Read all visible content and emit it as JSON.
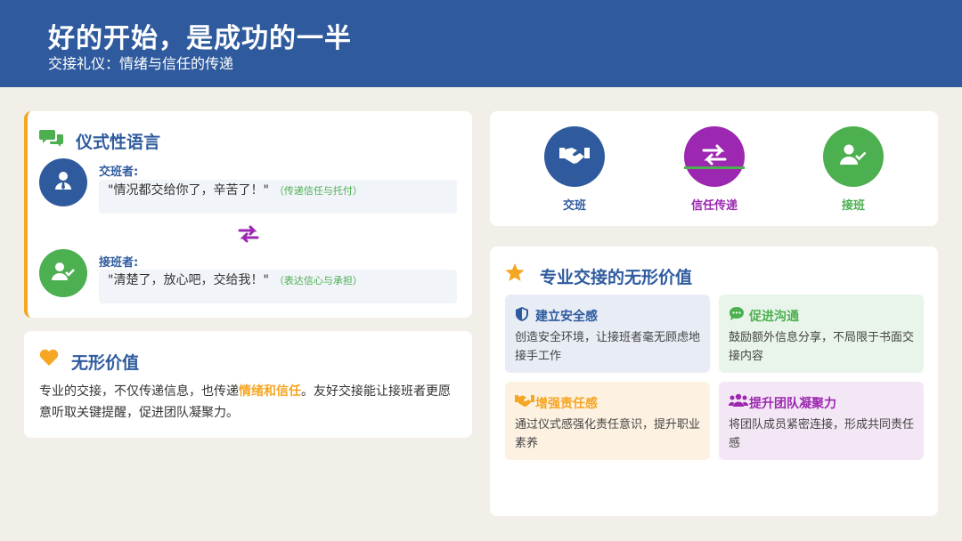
{
  "header": {
    "title": "好的开始，是成功的一半",
    "subtitle": "交接礼仪：情绪与信任的传递"
  },
  "ritual": {
    "title": "仪式性语言",
    "handover": {
      "role": "交班者:",
      "quote": "\"情况都交给你了，辛苦了！\"",
      "note": "（传递信任与托付）"
    },
    "takeover": {
      "role": "接班者:",
      "quote": "\"清楚了，放心吧，交给我！\"",
      "note": "（表达信心与承担）"
    }
  },
  "value": {
    "title": "无形价值",
    "text_before": "专业的交接，不仅传递信息，也传递",
    "text_highlight": "情绪和信任",
    "text_after": "。友好交接能让接班者更愿意听取关键提醒，促进团队凝聚力。"
  },
  "flow": {
    "steps": [
      {
        "label": "交班",
        "color": "#2f5b9e"
      },
      {
        "label": "信任传递",
        "color": "#9c27b0"
      },
      {
        "label": "接班",
        "color": "#4caf50"
      }
    ]
  },
  "intangible": {
    "title": "专业交接的无形价值",
    "tiles": [
      {
        "title": "建立安全感",
        "desc": "创造安全环境，让接班者毫无顾虑地接手工作",
        "color": "#2f5b9e",
        "bg": "#e8ecf5"
      },
      {
        "title": "促进沟通",
        "desc": "鼓励额外信息分享，不局限于书面交接内容",
        "color": "#4caf50",
        "bg": "#e9f5ea"
      },
      {
        "title": "增强责任感",
        "desc": "通过仪式感强化责任意识，提升职业素养",
        "color": "#f5a623",
        "bg": "#fdf2e2"
      },
      {
        "title": "提升团队凝聚力",
        "desc": "将团队成员紧密连接，形成共同责任感",
        "color": "#9c27b0",
        "bg": "#f3e7f5"
      }
    ]
  },
  "colors": {
    "primary": "#2f5b9e",
    "accent_orange": "#f5a623",
    "accent_green": "#4caf50",
    "accent_purple": "#9c27b0"
  }
}
